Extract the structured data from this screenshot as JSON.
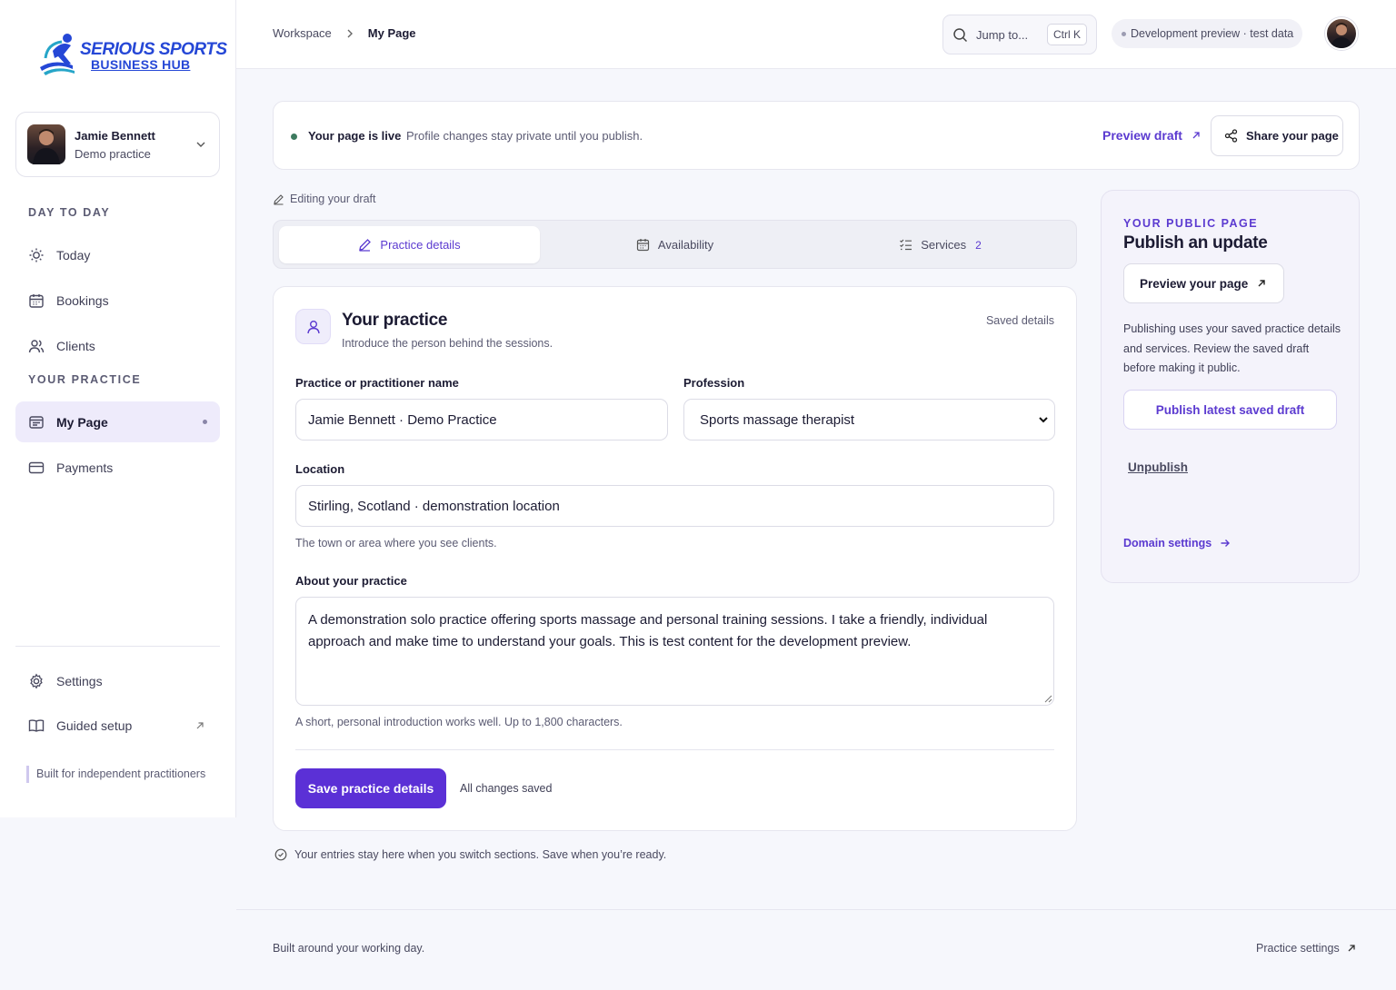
{
  "brand": {
    "line1": "SERIOUS SPORTS",
    "line2": "BUSINESS HUB",
    "color": "#2547d6"
  },
  "profile": {
    "name": "Jamie Bennett",
    "subtitle": "Demo practice"
  },
  "sidebar": {
    "section1": "DAY TO DAY",
    "section2": "YOUR PRACTICE",
    "items": [
      {
        "label": "Today",
        "icon": "sun-icon"
      },
      {
        "label": "Bookings",
        "icon": "calendar-icon"
      },
      {
        "label": "Clients",
        "icon": "users-icon"
      },
      {
        "label": "My Page",
        "icon": "page-icon",
        "active": true
      },
      {
        "label": "Payments",
        "icon": "card-icon"
      }
    ],
    "bottom": [
      {
        "label": "Settings",
        "icon": "gear-icon"
      },
      {
        "label": "Guided setup",
        "icon": "book-icon"
      }
    ],
    "tagline": "Built for independent practitioners"
  },
  "topbar": {
    "breadcrumb": [
      "Workspace",
      "My Page"
    ],
    "search_label": "Jump to...",
    "shortcut": "Ctrl K",
    "env_pill": "Development preview · test data"
  },
  "banner": {
    "title": "Your page is live",
    "subtitle": "Profile changes stay private until you publish.",
    "preview_link": "Preview draft",
    "share_button": "Share your page"
  },
  "editing_note": "Editing your draft",
  "tabs": [
    {
      "label": "Practice details",
      "active": true
    },
    {
      "label": "Availability"
    },
    {
      "label": "Services",
      "count": "2"
    }
  ],
  "form": {
    "title": "Your practice",
    "subtitle": "Introduce the person behind the sessions.",
    "status": "Saved details",
    "name_label": "Practice or practitioner name",
    "name_value": "Jamie Bennett · Demo Practice",
    "profession_label": "Profession",
    "profession_value": "Sports massage therapist",
    "location_label": "Location",
    "location_value": "Stirling, Scotland · demonstration location",
    "location_hint": "The town or area where you see clients.",
    "about_label": "About your practice",
    "about_value": "A demonstration solo practice offering sports massage and personal training sessions. I take a friendly, individual approach and make time to understand your goals. This is test content for the development preview.",
    "about_hint": "A short, personal introduction works well. Up to 1,800 characters.",
    "save_button": "Save practice details",
    "save_status": "All changes saved"
  },
  "footnote": "Your entries stay here when you switch sections. Save when you’re ready.",
  "publish_panel": {
    "eyebrow": "YOUR PUBLIC PAGE",
    "title": "Publish an update",
    "preview_button": "Preview your page",
    "description": "Publishing uses your saved practice details and services. Review the saved draft before making it public.",
    "publish_button": "Publish latest saved draft",
    "unpublish": "Unpublish",
    "domain_link": "Domain settings"
  },
  "footer": {
    "left": "Built around your working day.",
    "right": "Practice settings"
  },
  "colors": {
    "accent": "#5b30d6",
    "live": "#3d7a5f"
  }
}
